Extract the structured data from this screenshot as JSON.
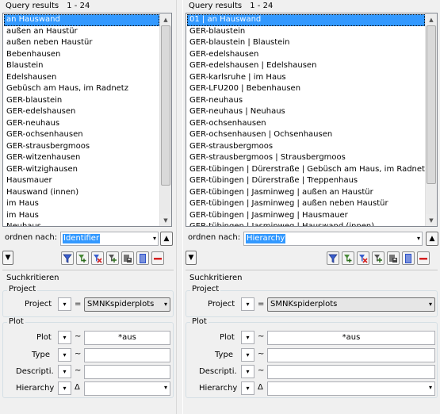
{
  "left": {
    "header": {
      "title": "Query results",
      "range": "1 - 24"
    },
    "list_items": [
      "an Hauswand",
      "außen an Haustür",
      "außen neben Haustür",
      "Bebenhausen",
      "Blaustein",
      "Edelshausen",
      "Gebüsch am Haus, im Radnetz",
      "GER-blaustein",
      "GER-edelshausen",
      "GER-neuhaus",
      "GER-ochsenhausen",
      "GER-strausbergmoos",
      "GER-witzenhausen",
      "GER-witzighausen",
      "Hausmauer",
      "Hauswand (innen)",
      "im Haus",
      "im Haus",
      "Neuhaus"
    ],
    "selected_index": 0,
    "sort": {
      "label": "ordnen nach:",
      "value": "Identifier"
    },
    "search": {
      "title": "Suchkritieren",
      "project_group": "Project",
      "project_label": "Project",
      "project_op": "=",
      "project_value": "SMNKspiderplots",
      "plot_group": "Plot",
      "plot_label": "Plot",
      "plot_op": "~",
      "plot_value": "*aus",
      "type_label": "Type",
      "type_op": "~",
      "type_value": "",
      "descr_label": "Descripti.",
      "descr_op": "~",
      "descr_value": "",
      "hierarchy_label": "Hierarchy",
      "hierarchy_op": "Δ",
      "hierarchy_value": ""
    }
  },
  "right": {
    "header": {
      "title": "Query results",
      "range": "1 - 24"
    },
    "list_items": [
      "01 | an Hauswand",
      "GER-blaustein",
      "GER-blaustein | Blaustein",
      "GER-edelshausen",
      "GER-edelshausen | Edelshausen",
      "GER-karlsruhe | im Haus",
      "GER-LFU200 | Bebenhausen",
      "GER-neuhaus",
      "GER-neuhaus | Neuhaus",
      "GER-ochsenhausen",
      "GER-ochsenhausen | Ochsenhausen",
      "GER-strausbergmoos",
      "GER-strausbergmoos | Strausbergmoos",
      "GER-tübingen | Dürerstraße | Gebüsch am Haus, im Radnetz",
      "GER-tübingen | Dürerstraße | Treppenhaus",
      "GER-tübingen | Jasminweg | außen an Haustür",
      "GER-tübingen | Jasminweg | außen neben Haustür",
      "GER-tübingen | Jasminweg | Hausmauer",
      "GER-tübingen | Jasminweg | Hauswand (innen)"
    ],
    "selected_index": 0,
    "sort": {
      "label": "ordnen nach:",
      "value": "Hierarchy"
    },
    "search": {
      "title": "Suchkritieren",
      "project_group": "Project",
      "project_label": "Project",
      "project_op": "=",
      "project_value": "SMNKspiderplots",
      "plot_group": "Plot",
      "plot_label": "Plot",
      "plot_op": "~",
      "plot_value": "*aus",
      "type_label": "Type",
      "type_op": "~",
      "type_value": "",
      "descr_label": "Descripti.",
      "descr_op": "~",
      "descr_value": "",
      "hierarchy_label": "Hierarchy",
      "hierarchy_op": "Δ",
      "hierarchy_value": ""
    }
  },
  "icons": {
    "toolbar": [
      "filter-icon",
      "add-filter-icon",
      "remove-filter-icon",
      "add-to-list-icon",
      "save-list-icon",
      "list-view-icon",
      "remove-icon"
    ],
    "scroll_up": "▲",
    "scroll_down": "▼",
    "sort_up": "▲",
    "sort_down": "▼",
    "dropdown": "▾"
  },
  "colors": {
    "selection": "#3399ff",
    "remove": "#d42020",
    "list_view": "#2a4fc8"
  }
}
